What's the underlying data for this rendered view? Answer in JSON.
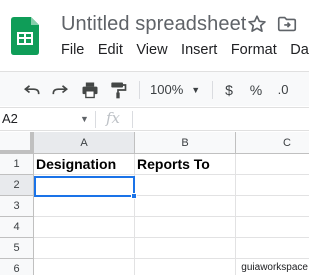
{
  "app": {
    "doc_title": "Untitled spreadsheet",
    "menu": [
      "File",
      "Edit",
      "View",
      "Insert",
      "Format",
      "Da"
    ]
  },
  "toolbar": {
    "zoom": "100%",
    "currency": "$",
    "percent": "%",
    "decimal": ".0"
  },
  "formula_bar": {
    "name_box": "A2",
    "fx": "fx",
    "value": ""
  },
  "grid": {
    "columns": [
      "A",
      "B",
      "C"
    ],
    "rows": [
      "1",
      "2",
      "3",
      "4",
      "5",
      "6"
    ],
    "cells": {
      "A1": "Designation",
      "B1": "Reports To"
    },
    "selected_cell": "A2"
  },
  "watermark": "guiaworkspace",
  "colors": {
    "logo_green": "#0f9d58",
    "selection_blue": "#1a73e8"
  },
  "icons": [
    "sheets-logo-icon",
    "star-icon",
    "move-to-folder-icon",
    "undo-icon",
    "redo-icon",
    "print-icon",
    "paint-format-icon",
    "chevron-down-icon",
    "fx-icon"
  ]
}
